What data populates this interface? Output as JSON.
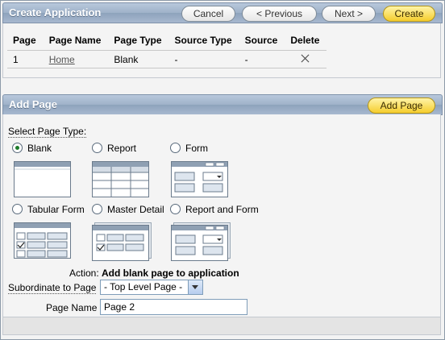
{
  "create_region": {
    "title": "Create Application",
    "buttons": {
      "cancel": "Cancel",
      "previous": "< Previous",
      "next": "Next >",
      "create": "Create"
    },
    "table": {
      "headers": [
        "Page",
        "Page Name",
        "Page Type",
        "Source Type",
        "Source",
        "Delete"
      ],
      "rows": [
        {
          "page": "1",
          "page_name": "Home",
          "page_type": "Blank",
          "source_type": "-",
          "source": "-"
        }
      ]
    }
  },
  "add_region": {
    "title": "Add Page",
    "add_button": "Add Page",
    "select_label": "Select Page Type:",
    "page_types": [
      {
        "label": "Blank",
        "selected": true,
        "icon": "blank-page-icon"
      },
      {
        "label": "Report",
        "selected": false,
        "icon": "report-page-icon"
      },
      {
        "label": "Form",
        "selected": false,
        "icon": "form-page-icon"
      },
      {
        "label": "Tabular Form",
        "selected": false,
        "icon": "tabular-form-page-icon"
      },
      {
        "label": "Master Detail",
        "selected": false,
        "icon": "master-detail-page-icon"
      },
      {
        "label": "Report and Form",
        "selected": false,
        "icon": "report-and-form-page-icon"
      }
    ],
    "action_label": "Action:",
    "action_value": "Add blank page to application",
    "subordinate_label": "Subordinate to Page",
    "subordinate_value": "- Top Level Page -",
    "page_name_label": "Page Name",
    "page_name_value": "Page 2"
  },
  "colors": {
    "header_blue": "#9fb2c9",
    "hot_button": "#f5cd2d",
    "radio_selected": "#1c7b2a"
  }
}
